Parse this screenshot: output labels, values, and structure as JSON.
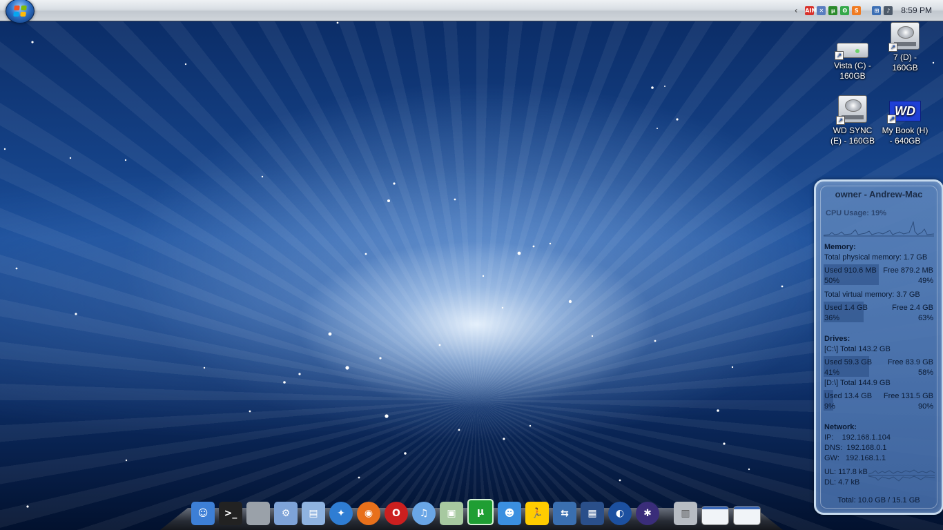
{
  "taskbar": {
    "tray_icons": [
      {
        "name": "aim-icon",
        "color": "#d8302b",
        "glyph": "AIM"
      },
      {
        "name": "network-warning-icon",
        "color": "#5a7ec0",
        "glyph": "✕"
      },
      {
        "name": "bittorrent-icon",
        "color": "#2b8a2b",
        "glyph": "µ"
      },
      {
        "name": "green-app-icon",
        "color": "#35a84a",
        "glyph": "ʘ"
      },
      {
        "name": "orange-app-icon",
        "color": "#f07b22",
        "glyph": "S"
      },
      {
        "name": "network-icon",
        "color": "#3c6fb5",
        "glyph": "⊞"
      },
      {
        "name": "volume-icon",
        "color": "#4d5a6a",
        "glyph": "♪"
      }
    ],
    "clock": "8:59 PM"
  },
  "desktop_icons": [
    {
      "name": "vista-c-drive",
      "label": "Vista (C) - 160GB",
      "type": "flat-drive"
    },
    {
      "name": "seven-d-drive",
      "label": "7 (D) - 160GB",
      "type": "drive"
    },
    {
      "name": "wd-sync-e-drive",
      "label": "WD SYNC (E) - 160GB",
      "type": "drive"
    },
    {
      "name": "my-book-h-drive",
      "label": "My Book (H) - 640GB",
      "type": "wd",
      "logo_text": "WD"
    }
  ],
  "gadget": {
    "title": "owner - Andrew-Mac",
    "cpu_usage": "CPU Usage: 19%",
    "cpu_percent": 19,
    "memory": {
      "heading": "Memory:",
      "total_physical": "Total physical memory: 1.7 GB",
      "physical_used": "Used 910.6 MB",
      "physical_free": "Free 879.2 MB",
      "physical_used_pct": "50%",
      "physical_free_pct": "49%",
      "physical_fraction": 0.5,
      "total_virtual": "Total virtual memory: 3.7 GB",
      "virtual_used": "Used 1.4 GB",
      "virtual_free": "Free 2.4 GB",
      "virtual_used_pct": "36%",
      "virtual_free_pct": "63%",
      "virtual_fraction": 0.36
    },
    "drives": {
      "heading": "Drives:",
      "c_total": "[C:\\] Total 143.2 GB",
      "c_used": "Used 59.3 GB",
      "c_free": "Free 83.9 GB",
      "c_used_pct": "41%",
      "c_free_pct": "58%",
      "c_fraction": 0.41,
      "d_total": "[D:\\] Total 144.9 GB",
      "d_used": "Used 13.4 GB",
      "d_free": "Free 131.5 GB",
      "d_used_pct": "9%",
      "d_free_pct": "90%",
      "d_fraction": 0.09
    },
    "network": {
      "heading": "Network:",
      "ip": "IP:    192.168.1.104",
      "dns": "DNS:  192.168.0.1",
      "gw": "GW:   192.168.1.1",
      "ul": "UL: 117.8 kB",
      "dl": "DL: 4.7 kB"
    },
    "total": "Total: 10.0 GB / 15.1 GB"
  },
  "dock": {
    "items": [
      {
        "name": "finder-icon",
        "color": "#3d7fd6",
        "glyph": "☺"
      },
      {
        "name": "terminal-icon",
        "color": "#222222",
        "glyph": ">_"
      },
      {
        "name": "apple-icon",
        "color": "#9aa1a9",
        "glyph": ""
      },
      {
        "name": "preferences-icon",
        "color": "#7ea3d8",
        "glyph": "⚙"
      },
      {
        "name": "folder-icon",
        "color": "#8fb3e0",
        "glyph": "▤"
      },
      {
        "name": "safari-icon",
        "color": "#2f7dd3",
        "glyph": "✦"
      },
      {
        "name": "firefox-icon",
        "color": "#e8701b",
        "glyph": "◉"
      },
      {
        "name": "opera-icon",
        "color": "#cc1f1f",
        "glyph": "O"
      },
      {
        "name": "itunes-icon",
        "color": "#6aa6e6",
        "glyph": "♫"
      },
      {
        "name": "ipod-icon",
        "color": "#a7c9a0",
        "glyph": "▣"
      },
      {
        "name": "utorrent-icon",
        "color": "#1f9e33",
        "glyph": "µ"
      },
      {
        "name": "messenger-icon",
        "color": "#3b8fe0",
        "glyph": "☻"
      },
      {
        "name": "aim-dock-icon",
        "color": "#ffcc00",
        "glyph": "🏃"
      },
      {
        "name": "network-share-icon",
        "color": "#3a6fb0",
        "glyph": "⇆"
      },
      {
        "name": "image-viewer-icon",
        "color": "#2a4f8a",
        "glyph": "▦"
      },
      {
        "name": "google-earth-icon",
        "color": "#1c50a0",
        "glyph": "◐"
      },
      {
        "name": "gimp-icon",
        "color": "#3a2d7a",
        "glyph": "✱"
      },
      {
        "name": "trash-icon",
        "color": "#b7bcc3",
        "glyph": "▥"
      },
      {
        "name": "window-thumb-1-icon",
        "color": "#e6ebf2",
        "glyph": ""
      },
      {
        "name": "window-thumb-2-icon",
        "color": "#e6ebf2",
        "glyph": ""
      }
    ]
  }
}
